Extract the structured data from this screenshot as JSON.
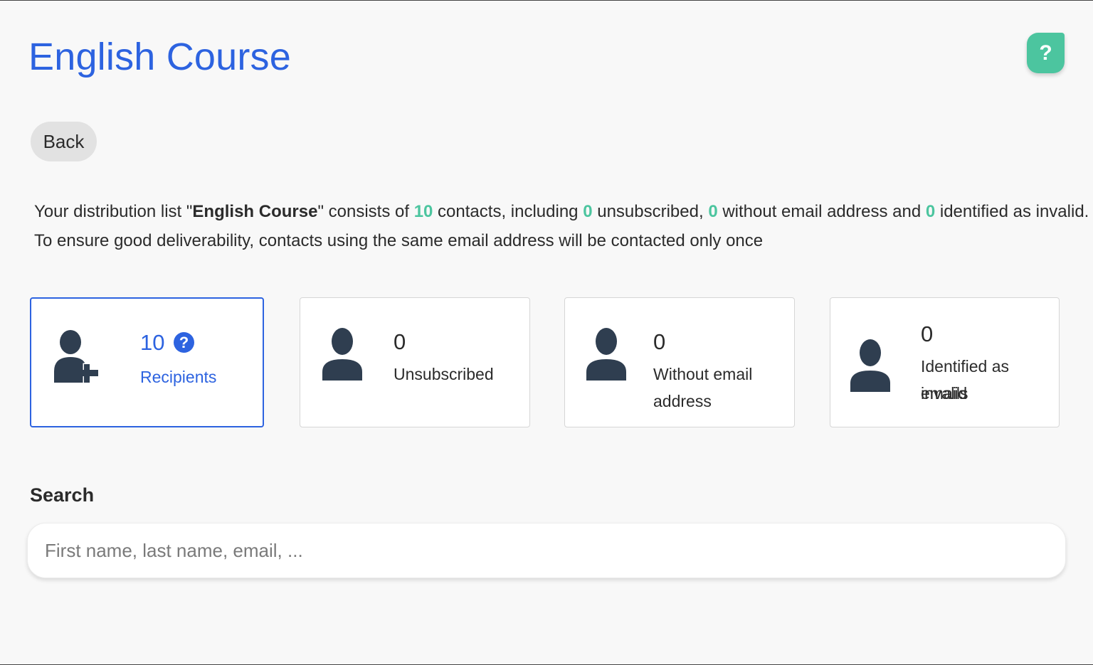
{
  "header": {
    "title": "English Course",
    "help_label": "?"
  },
  "toolbar": {
    "back_label": "Back"
  },
  "summary": {
    "part1": "Your distribution list \"",
    "list_name": "English Course",
    "part2": "\" consists of ",
    "contacts_count": "10",
    "part3": " contacts, including ",
    "unsubscribed_count": "0",
    "part4": " unsubscribed, ",
    "no_email_count": "0",
    "part5": " without email address and ",
    "invalid_count": "0",
    "part6": " identified as invalid.",
    "line2": "To ensure good deliverability, contacts using the same email address will be contacted only once"
  },
  "cards": [
    {
      "count": "10",
      "label": "Recipients",
      "icon": "add-user-icon",
      "help": "?",
      "active": true
    },
    {
      "count": "0",
      "label": "Unsubscribed",
      "icon": "user-icon",
      "active": false
    },
    {
      "count": "0",
      "label": "Without email address",
      "icon": "user-icon",
      "active": false
    },
    {
      "count": "0",
      "label_line1": "Identified as invalid",
      "label_line2": "emails",
      "icon": "user-icon",
      "active": false
    }
  ],
  "search": {
    "heading": "Search",
    "placeholder": "First name, last name, email, ...",
    "value": ""
  },
  "colors": {
    "accent": "#2d63e0",
    "highlight": "#4cc59f",
    "icon": "#2f3e50",
    "background": "#f8f8f8"
  }
}
